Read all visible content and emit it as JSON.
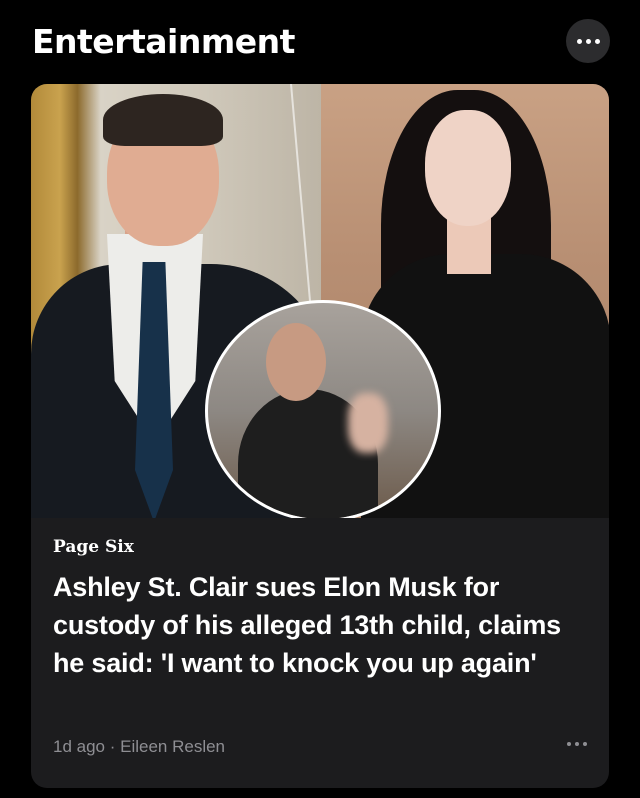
{
  "section": {
    "title": "Entertainment",
    "more_icon": "ellipsis-icon"
  },
  "article": {
    "publisher": "Page Six",
    "headline": "Ashley St. Clair sues Elon Musk for custody of his alleged 13th child, claims he said: 'I want to knock you up again'",
    "age": "1d ago",
    "separator": " · ",
    "author": "Eileen Reslen",
    "more_icon": "ellipsis-icon"
  },
  "colors": {
    "background": "#000000",
    "card": "#1c1c1e",
    "meta_text": "#8e8e93",
    "button": "#2c2c2e"
  }
}
